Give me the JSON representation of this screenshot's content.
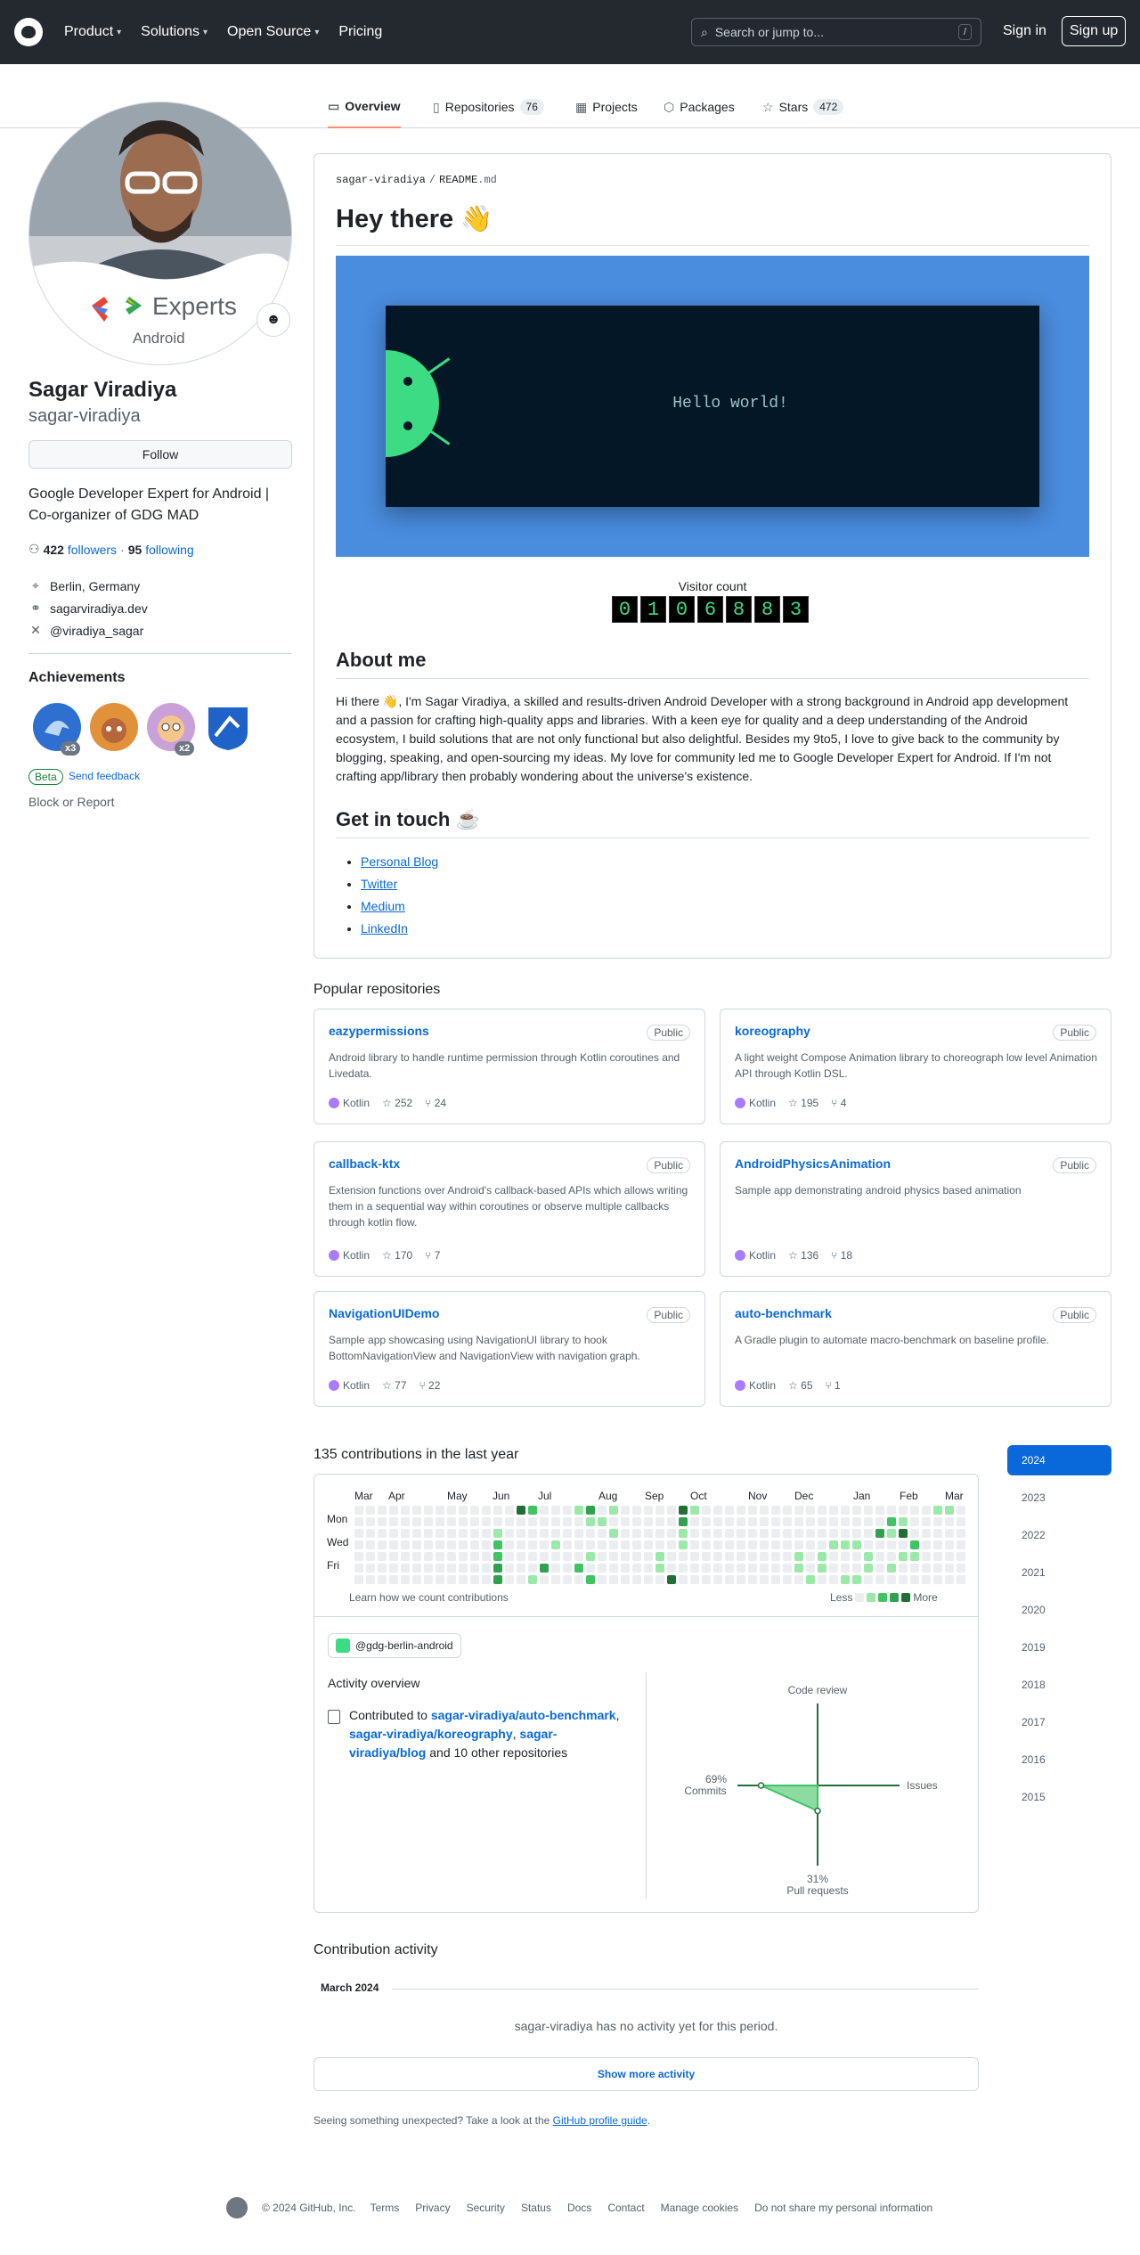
{
  "header": {
    "nav": [
      "Product",
      "Solutions",
      "Open Source",
      "Pricing"
    ],
    "search_placeholder": "Search or jump to...",
    "search_shortcut": "/",
    "signin": "Sign in",
    "signup": "Sign up"
  },
  "tabs": [
    {
      "label": "Overview",
      "count": ""
    },
    {
      "label": "Repositories",
      "count": "76"
    },
    {
      "label": "Projects",
      "count": ""
    },
    {
      "label": "Packages",
      "count": ""
    },
    {
      "label": "Stars",
      "count": "472"
    }
  ],
  "profile": {
    "avatar_text": "Experts",
    "avatar_subtext": "Android",
    "fullname": "Sagar Viradiya",
    "login": "sagar-viradiya",
    "follow": "Follow",
    "bio": "Google Developer Expert for Android | Co-organizer of GDG MAD",
    "followers_count": "422",
    "followers_label": "followers",
    "separator": "·",
    "following_count": "95",
    "following_label": "following",
    "location": "Berlin, Germany",
    "website": "sagarviradiya.dev",
    "twitter": "@viradiya_sagar",
    "achievements_title": "Achievements",
    "badges": [
      {
        "name": "pull-shark",
        "count": "x3",
        "color": "#2f6fd0"
      },
      {
        "name": "starstruck",
        "count": "",
        "color": "#e0913a"
      },
      {
        "name": "pair-extraordinaire",
        "count": "x2",
        "color": "#c9a0d8"
      },
      {
        "name": "arctic-code-vault",
        "count": "",
        "color": "#1f63c8"
      }
    ],
    "beta": "Beta",
    "feedback": "Send feedback",
    "block": "Block or Report"
  },
  "readme": {
    "path_user": "sagar-viradiya",
    "path_sep": "/",
    "path_file": "README",
    "path_ext": ".md",
    "title": "Hey there 👋",
    "banner_text": "Hello world!",
    "visitor_label": "Visitor count",
    "visitor_digits": [
      "0",
      "1",
      "0",
      "6",
      "8",
      "8",
      "3"
    ],
    "about_title": "About me",
    "about_text": "Hi there 👋, I'm Sagar Viradiya, a skilled and results-driven Android Developer with a strong background in Android app development and a passion for crafting high-quality apps and libraries. With a keen eye for quality and a deep understanding of the Android ecosystem, I build solutions that are not only functional but also delightful. Besides my 9to5, I love to give back to the community by blogging, speaking, and open-sourcing my ideas. My love for community led me to Google Developer Expert for Android. If I'm not crafting app/library then probably wondering about the universe's existence.",
    "touch_title": "Get in touch ☕",
    "links": [
      "Personal Blog",
      "Twitter",
      "Medium",
      "LinkedIn"
    ]
  },
  "popular": {
    "title": "Popular repositories",
    "public_label": "Public",
    "repos": [
      {
        "name": "eazypermissions",
        "desc": "Android library to handle runtime permission through Kotlin coroutines and Livedata.",
        "lang": "Kotlin",
        "stars": "252",
        "forks": "24"
      },
      {
        "name": "koreography",
        "desc": "A light weight Compose Animation library to choreograph low level Animation API through Kotlin DSL.",
        "lang": "Kotlin",
        "stars": "195",
        "forks": "4"
      },
      {
        "name": "callback-ktx",
        "desc": "Extension functions over Android's callback-based APIs which allows writing them in a sequential way within coroutines or observe multiple callbacks through kotlin flow.",
        "lang": "Kotlin",
        "stars": "170",
        "forks": "7"
      },
      {
        "name": "AndroidPhysicsAnimation",
        "desc": "Sample app demonstrating android physics based animation",
        "lang": "Kotlin",
        "stars": "136",
        "forks": "18"
      },
      {
        "name": "NavigationUIDemo",
        "desc": "Sample app showcasing using NavigationUI library to hook BottomNavigationView and NavigationView with navigation graph.",
        "lang": "Kotlin",
        "stars": "77",
        "forks": "22"
      },
      {
        "name": "auto-benchmark",
        "desc": "A Gradle plugin to automate macro-benchmark on baseline profile.",
        "lang": "Kotlin",
        "stars": "65",
        "forks": "1"
      }
    ],
    "kotlin_color": "#a97bff"
  },
  "contributions": {
    "title": "135 contributions in the last year",
    "years": [
      "2024",
      "2023",
      "2022",
      "2021",
      "2020",
      "2019",
      "2018",
      "2017",
      "2016",
      "2015"
    ],
    "months": [
      "Mar",
      "Apr",
      "May",
      "Jun",
      "Jul",
      "Aug",
      "Sep",
      "Oct",
      "Nov",
      "Dec",
      "Jan",
      "Feb",
      "Mar"
    ],
    "days": [
      "Mon",
      "Wed",
      "Fri"
    ],
    "learn": "Learn how we count contributions",
    "less": "Less",
    "more": "More",
    "level_colors": [
      "#ebedf0",
      "#9be9a8",
      "#40c463",
      "#30a14e",
      "#216e39"
    ],
    "org": "@gdg-berlin-android",
    "overview_title": "Activity overview",
    "overview_prefix": "Contributed to",
    "repo1": "sagar-viradiya/auto-benchmark",
    "repo2": "sagar-viradiya/koreography",
    "repo3": "sagar-viradiya/blog",
    "overview_suffix": "and 10 other repositories",
    "radar": {
      "code_review": "Code review",
      "issues": "Issues",
      "commits_pct": "69%",
      "commits": "Commits",
      "pr_pct": "31%",
      "pr": "Pull requests",
      "commits_value": 69,
      "pr_value": 31
    }
  },
  "activity": {
    "title": "Contribution activity",
    "month": "March 2024",
    "empty": "sagar-viradiya has no activity yet for this period.",
    "more": "Show more activity",
    "unexpected_prefix": "Seeing something unexpected? Take a look at the",
    "guide": "GitHub profile guide",
    "unexpected_suffix": "."
  },
  "footer": {
    "copyright": "© 2024 GitHub, Inc.",
    "links": [
      "Terms",
      "Privacy",
      "Security",
      "Status",
      "Docs",
      "Contact",
      "Manage cookies",
      "Do not share my personal information"
    ]
  }
}
